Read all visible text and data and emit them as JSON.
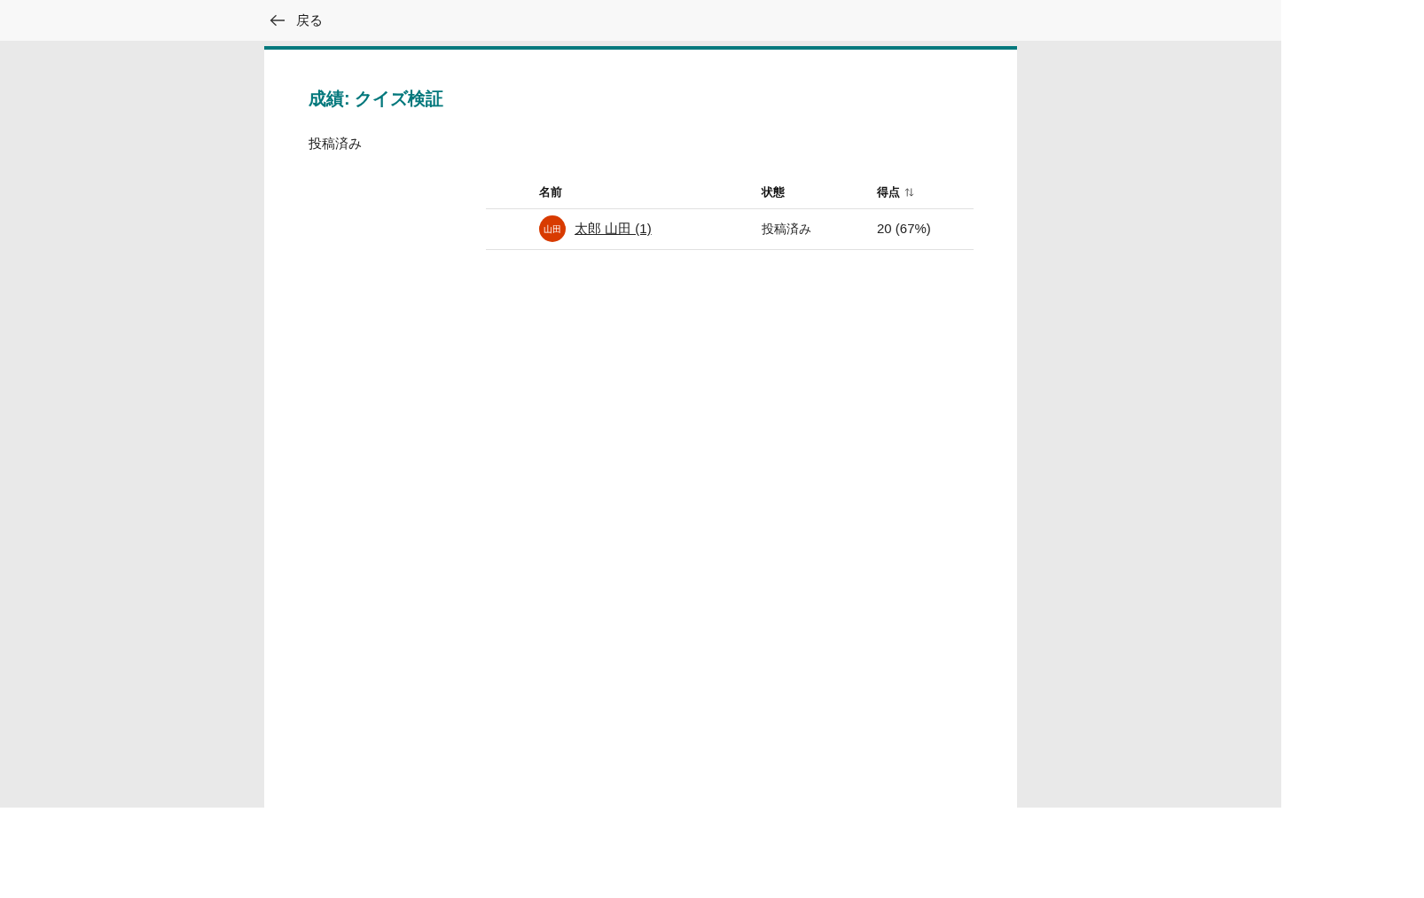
{
  "header": {
    "back_label": "戻る"
  },
  "page": {
    "title": "成績: クイズ検証",
    "subtitle": "投稿済み"
  },
  "table": {
    "columns": [
      {
        "label": "名前",
        "sortable": false
      },
      {
        "label": "状態",
        "sortable": false
      },
      {
        "label": "得点",
        "sortable": true
      }
    ],
    "rows": [
      {
        "avatar_initials": "山田",
        "color": "#d83b01",
        "name": "太郎 山田 (1)",
        "status": "投稿済み",
        "score": "20 (67%)"
      }
    ]
  }
}
